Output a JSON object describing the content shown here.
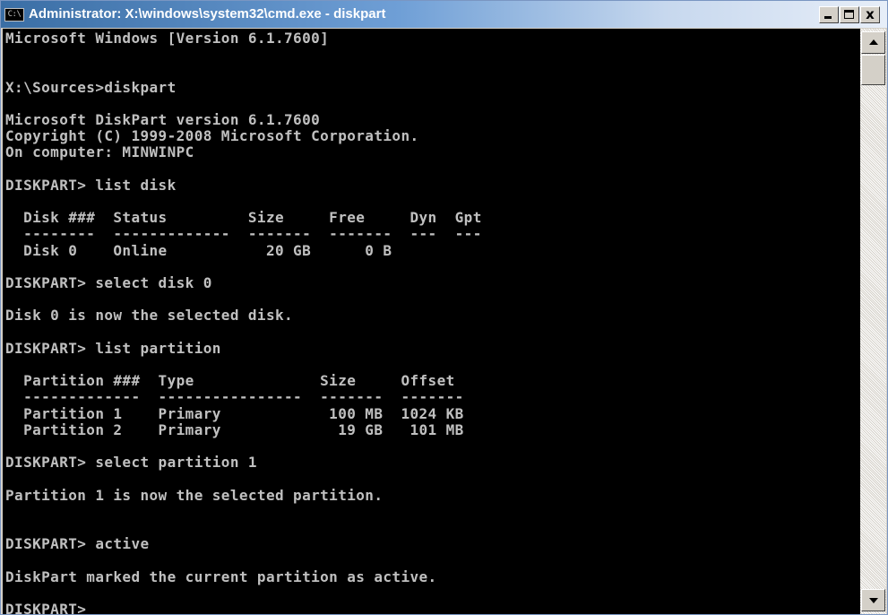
{
  "window": {
    "title": "Administrator: X:\\windows\\system32\\cmd.exe - diskpart",
    "icon_text": "C:\\",
    "controls": {
      "minimize": "minimize-icon",
      "maximize": "maximize-icon",
      "close_label": "x"
    }
  },
  "console": {
    "colors": {
      "background": "#000000",
      "text": "#c0c0c0"
    },
    "lines": [
      "Microsoft Windows [Version 6.1.7600]",
      "",
      "",
      "X:\\Sources>diskpart",
      "",
      "Microsoft DiskPart version 6.1.7600",
      "Copyright (C) 1999-2008 Microsoft Corporation.",
      "On computer: MINWINPC",
      "",
      "DISKPART> list disk",
      "",
      "  Disk ###  Status         Size     Free     Dyn  Gpt",
      "  --------  -------------  -------  -------  ---  ---",
      "  Disk 0    Online           20 GB      0 B",
      "",
      "DISKPART> select disk 0",
      "",
      "Disk 0 is now the selected disk.",
      "",
      "DISKPART> list partition",
      "",
      "  Partition ###  Type              Size     Offset",
      "  -------------  ----------------  -------  -------",
      "  Partition 1    Primary            100 MB  1024 KB",
      "  Partition 2    Primary             19 GB   101 MB",
      "",
      "DISKPART> select partition 1",
      "",
      "Partition 1 is now the selected partition.",
      "",
      "",
      "DISKPART> active",
      "",
      "DiskPart marked the current partition as active.",
      "",
      "DISKPART> "
    ]
  },
  "scrollbar": {
    "up_icon": "arrow-up-icon",
    "down_icon": "arrow-down-icon"
  }
}
